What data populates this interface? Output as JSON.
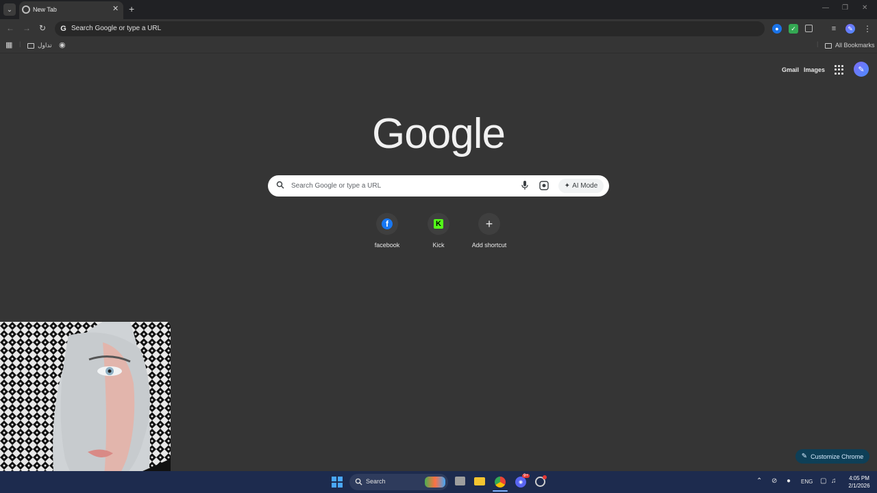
{
  "browser": {
    "tab_title": "New Tab",
    "omnibox_text": "Search Google or type a URL"
  },
  "bookmarks": {
    "folder_label": "تداول",
    "all_bookmarks": "All Bookmarks"
  },
  "header": {
    "gmail": "Gmail",
    "images": "Images"
  },
  "logo_text": "Google",
  "search": {
    "placeholder": "Search Google or type a URL",
    "ai_mode_label": "AI Mode"
  },
  "shortcuts": [
    {
      "label": "facebook",
      "icon": "facebook-icon"
    },
    {
      "label": "Kick",
      "icon": "kick-icon"
    },
    {
      "label": "Add shortcut",
      "icon": "plus-icon"
    }
  ],
  "customize_label": "Customize Chrome",
  "taskbar": {
    "search_label": "Search",
    "lang": "ENG",
    "time": "4:05 PM",
    "date": "2/1/2026",
    "discord_badge": "9+"
  },
  "colors": {
    "page_bg": "#353535",
    "taskbar_bg": "#1d2b4e",
    "customize_bg": "#0e3f57"
  }
}
